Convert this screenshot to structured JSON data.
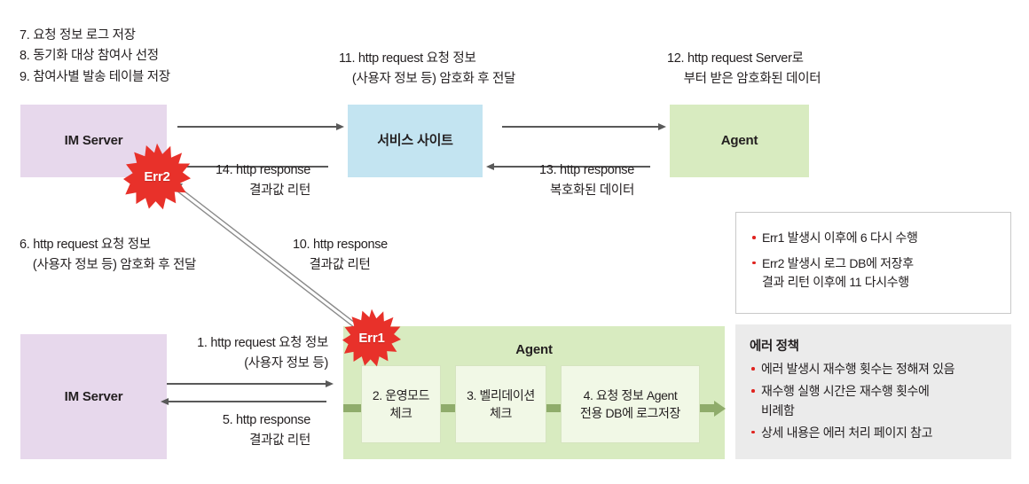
{
  "diagram": {
    "title": "IM Server - Service Site - Agent http request/response flow with error policy",
    "colors": {
      "im_server": "#e7d8ec",
      "service_site": "#c3e4f1",
      "agent": "#d8ebc0",
      "error_burst": "#e8312a",
      "bullet": "#e0231f",
      "policy_bg": "#ebebeb",
      "arrow": "#595959",
      "pipeline_arrow": "#8fac6b"
    }
  },
  "top_notes": {
    "left": "7. 요청 정보 로그 저장\n8. 동기화 대상 참여사 선정\n9. 참여사별 발송 테이블 저장",
    "middle": "11. http request 요청 정보\n    (사용자 정보 등) 암호화 후 전달",
    "right": "12. http request Server로\n     부터 받은 암호화된 데이터"
  },
  "top_row": {
    "im_server_label": "IM Server",
    "service_site_label": "서비스 사이트",
    "agent_label": "Agent",
    "response_14": "14. http response\n결과값 리턴",
    "response_13": "13. http response\n복호화된 데이터"
  },
  "middle_notes": {
    "request_6": "6. http request 요청 정보\n    (사용자 정보 등) 암호화 후 전달",
    "response_10": "10. http response\n     결과값 리턴"
  },
  "bursts": {
    "err2": "Err2",
    "err1": "Err1"
  },
  "note_panel": {
    "bullets": [
      "Err1 발생시 이후에 6 다시 수행",
      "Err2 발생시 로그 DB에 저장후\n결과 리턴 이후에 11 다시수행"
    ]
  },
  "policy_panel": {
    "title": "에러 정책",
    "bullets": [
      "에러 발생시 재수행 횟수는 정해져 있음",
      "재수행 실행 시간은 재수행 횟수에\n비례함",
      "상세 내용은 에러 처리 페이지 참고"
    ]
  },
  "bottom_row": {
    "im_server_label": "IM Server",
    "request_1": "1. http request 요청 정보\n       (사용자 정보 등)",
    "response_5": "5. http response\n결과값 리턴",
    "agent_title": "Agent",
    "steps": [
      "2. 운영모드\n체크",
      "3. 벨리데이션\n체크",
      "4. 요청 정보 Agent\n전용 DB에 로그저장"
    ]
  }
}
